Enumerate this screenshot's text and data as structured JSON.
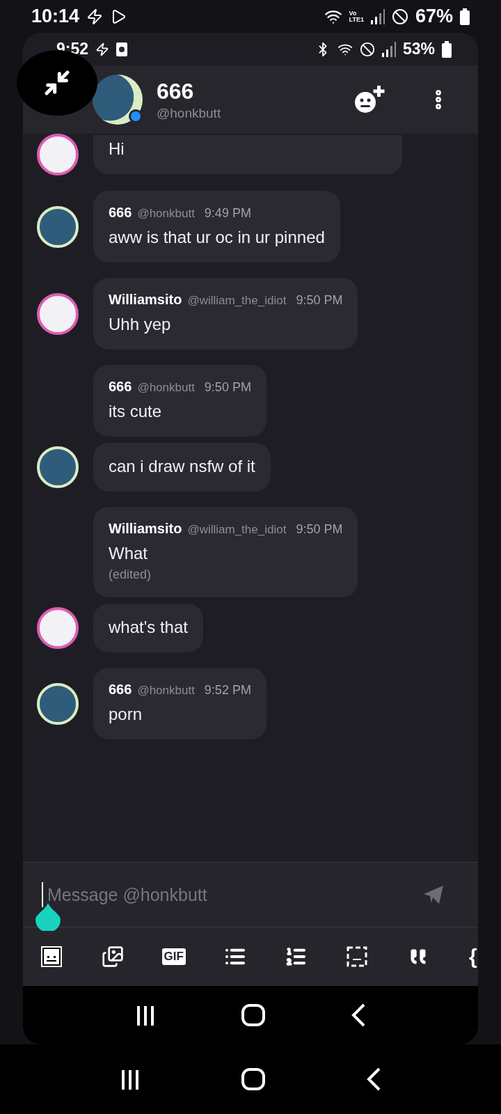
{
  "phone_status": {
    "time": "10:14",
    "network": "Vo\nLTE1",
    "battery": "67%"
  },
  "app_status": {
    "time": "9:52",
    "battery": "53%"
  },
  "header": {
    "name": "666",
    "handle": "@honkbutt",
    "online": true
  },
  "messages": [
    {
      "avatar": {
        "kind": "ring",
        "color": "#e05bb4"
      },
      "cut_top": true,
      "text": "Hi"
    },
    {
      "avatar": {
        "kind": "fill",
        "color": "#2f5c7a"
      },
      "cut_top": false,
      "author": {
        "name": "666",
        "handle": "@honkbutt",
        "time": "9:49 PM"
      },
      "text": "aww is that ur oc in ur pinned"
    },
    {
      "avatar": {
        "kind": "ring",
        "color": "#e05bb4"
      },
      "cut_top": false,
      "author": {
        "name": "Williamsito",
        "handle": "@william_the_idiot",
        "time": "9:50 PM"
      },
      "text": "Uhh yep"
    },
    {
      "cut_top": false,
      "author": {
        "name": "666",
        "handle": "@honkbutt",
        "time": "9:50 PM"
      },
      "text": "its cute"
    },
    {
      "avatar": {
        "kind": "fill",
        "color": "#2f5c7a"
      },
      "cut_top": false,
      "text": "can i draw nsfw of it"
    },
    {
      "cut_top": false,
      "author": {
        "name": "Williamsito",
        "handle": "@william_the_idiot",
        "time": "9:50 PM"
      },
      "text": "What",
      "note": "(edited)"
    },
    {
      "avatar": {
        "kind": "ring",
        "color": "#e05bb4"
      },
      "cut_top": false,
      "text": "what's that"
    },
    {
      "avatar": {
        "kind": "fill",
        "color": "#2f5c7a"
      },
      "cut_top": false,
      "author": {
        "name": "666",
        "handle": "@honkbutt",
        "time": "9:52 PM"
      },
      "text": "porn"
    }
  ],
  "composer": {
    "placeholder": "Message @honkbutt"
  },
  "toolbar": {
    "gif": "GIF",
    "brace": "{"
  }
}
